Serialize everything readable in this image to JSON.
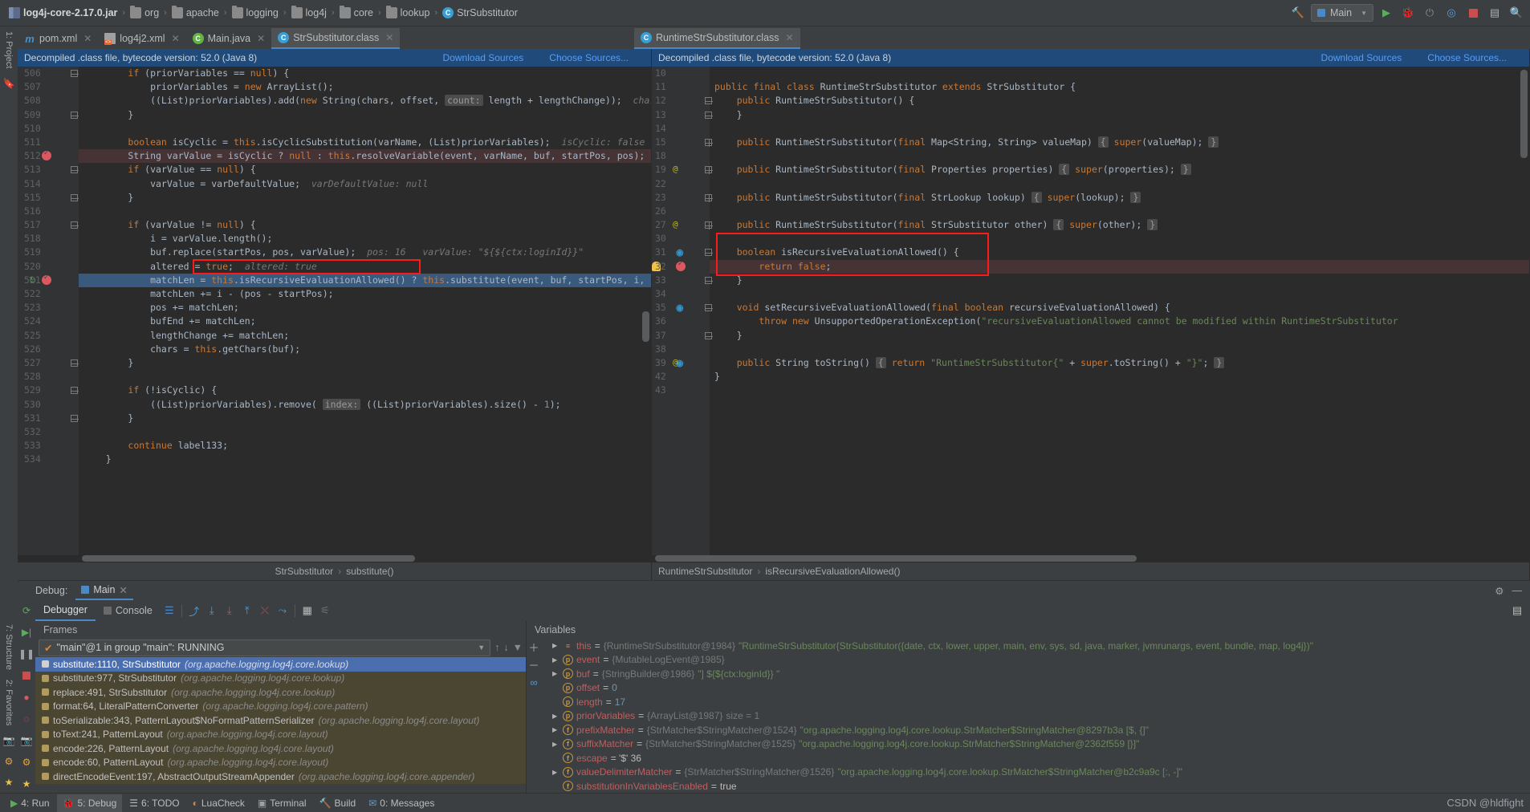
{
  "navbar": {
    "crumbs": [
      {
        "icon": "jar-icon",
        "label": "log4j-core-2.17.0.jar",
        "bold": true
      },
      {
        "icon": "folder-icon",
        "label": "org"
      },
      {
        "icon": "folder-icon",
        "label": "apache"
      },
      {
        "icon": "folder-icon",
        "label": "logging"
      },
      {
        "icon": "folder-icon",
        "label": "log4j"
      },
      {
        "icon": "folder-icon",
        "label": "core"
      },
      {
        "icon": "folder-icon",
        "label": "lookup"
      },
      {
        "icon": "class-icon",
        "label": "StrSubstitutor"
      }
    ],
    "run_config": "Main",
    "buttons": [
      "build-icon",
      "run-icon",
      "debug-icon",
      "attach-icon",
      "coverage-icon",
      "profile-icon",
      "stop-icon",
      "layout-icon",
      "search-icon"
    ]
  },
  "tabs_left": [
    {
      "icon": "maven-icon",
      "label": "pom.xml",
      "active": false
    },
    {
      "icon": "xml-icon",
      "label": "log4j2.xml",
      "active": false
    },
    {
      "icon": "java-class-icon",
      "label": "Main.java",
      "active": false
    },
    {
      "icon": "class-icon",
      "label": "StrSubstitutor.class",
      "active": true
    }
  ],
  "tabs_right": [
    {
      "icon": "class-icon",
      "label": "RuntimeStrSubstitutor.class",
      "active": true
    }
  ],
  "editor_left": {
    "notification": "Decompiled .class file, bytecode version: 52.0 (Java 8)",
    "link_download": "Download Sources",
    "link_choose": "Choose Sources...",
    "breadcrumb": [
      "StrSubstitutor",
      "substitute()"
    ],
    "lines": [
      {
        "n": "506",
        "fold": "minus",
        "html": "        <k>if</k> (priorVariables == <k>null</k>) {"
      },
      {
        "n": "507",
        "html": "            priorVariables = <k>new</k> ArrayList();"
      },
      {
        "n": "508",
        "html": "            ((List)priorVariables).add(<k>new</k> String(chars, offset, <b>count:</b> length + lengthChange));  <h>chars: {},  , $, {, c, t,</h>"
      },
      {
        "n": "509",
        "fold": "box",
        "html": "        }"
      },
      {
        "n": "510",
        "html": ""
      },
      {
        "n": "511",
        "html": "        <k>boolean</k> isCyclic = <k>this</k>.isCyclicSubstitution(varName, (List)priorVariables);  <h>isCyclic: false</h>"
      },
      {
        "n": "512",
        "bp": true,
        "bphl": true,
        "html": "        String varValue = isCyclic ? <k>null</k> : <k>this</k>.resolveVariable(event, varName, buf, startPos, pos);  <h>varValue: \"${${ctx:l</h>"
      },
      {
        "n": "513",
        "fold": "minus",
        "html": "        <k>if</k> (varValue == <k>null</k>) {"
      },
      {
        "n": "514",
        "html": "            varValue = varDefaultValue;  <h>varDefaultValue: null</h>"
      },
      {
        "n": "515",
        "fold": "box",
        "html": "        }"
      },
      {
        "n": "516",
        "html": ""
      },
      {
        "n": "517",
        "fold": "minus",
        "html": "        <k>if</k> (varValue != <k>null</k>) {"
      },
      {
        "n": "518",
        "html": "            i = varValue.length();"
      },
      {
        "n": "519",
        "html": "            buf.replace(startPos, pos, varValue);  <h>pos: 16   varValue: \"${${ctx:loginId}}\"</h>"
      },
      {
        "n": "520",
        "html": "            altered = <k>true</k>;  <h>altered: true</h>"
      },
      {
        "n": "521",
        "cur": true,
        "bp": true,
        "exec": true,
        "html": "            matchLen = <k>this</k>.isRecursiveEvaluationAllowed() ? <k>this</k>.substitute(event, buf, startPos, i, (List)priorVariables)"
      },
      {
        "n": "522",
        "html": "            matchLen += i - (pos - startPos);"
      },
      {
        "n": "523",
        "html": "            pos += matchLen;"
      },
      {
        "n": "524",
        "html": "            bufEnd += matchLen;"
      },
      {
        "n": "525",
        "html": "            lengthChange += matchLen;"
      },
      {
        "n": "526",
        "html": "            chars = <k>this</k>.getChars(buf);"
      },
      {
        "n": "527",
        "fold": "box",
        "html": "        }"
      },
      {
        "n": "528",
        "html": ""
      },
      {
        "n": "529",
        "fold": "minus",
        "html": "        <k>if</k> (!isCyclic) {"
      },
      {
        "n": "530",
        "html": "            ((List)priorVariables).remove( <b>index:</b> ((List)priorVariables).size() - <n>1</n>);"
      },
      {
        "n": "531",
        "fold": "box",
        "html": "        }"
      },
      {
        "n": "532",
        "html": ""
      },
      {
        "n": "533",
        "html": "        <k>continue</k> label133;"
      },
      {
        "n": "534",
        "html": "    }"
      }
    ]
  },
  "editor_right": {
    "notification": "Decompiled .class file, bytecode version: 52.0 (Java 8)",
    "link_download": "Download Sources",
    "link_choose": "Choose Sources...",
    "breadcrumb": [
      "RuntimeStrSubstitutor",
      "isRecursiveEvaluationAllowed()"
    ],
    "lines": [
      {
        "n": "10",
        "html": ""
      },
      {
        "n": "11",
        "html": "<k>public</k> <k>final</k> <k>class</k> RuntimeStrSubstitutor <k>extends</k> StrSubstitutor {"
      },
      {
        "n": "12",
        "fold": "minus",
        "html": "    <k>public</k> RuntimeStrSubstitutor() {"
      },
      {
        "n": "13",
        "fold": "box",
        "html": "    }"
      },
      {
        "n": "14",
        "html": ""
      },
      {
        "n": "15",
        "fold": "plus",
        "html": "    <k>public</k> RuntimeStrSubstitutor(<k>final</k> Map&lt;String, String&gt; valueMap) <b>{</b> <k>super</k>(valueMap); <b>}</b>"
      },
      {
        "n": "18",
        "html": ""
      },
      {
        "n": "19",
        "at": true,
        "fold": "plus",
        "html": "    <k>public</k> RuntimeStrSubstitutor(<k>final</k> Properties properties) <b>{</b> <k>super</k>(properties); <b>}</b>"
      },
      {
        "n": "22",
        "html": ""
      },
      {
        "n": "23",
        "fold": "plus",
        "html": "    <k>public</k> RuntimeStrSubstitutor(<k>final</k> StrLookup lookup) <b>{</b> <k>super</k>(lookup); <b>}</b>"
      },
      {
        "n": "26",
        "html": ""
      },
      {
        "n": "27",
        "at": true,
        "fold": "plus",
        "html": "    <k>public</k> RuntimeStrSubstitutor(<k>final</k> StrSubstitutor other) <b>{</b> <k>super</k>(other); <b>}</b>"
      },
      {
        "n": "30",
        "html": ""
      },
      {
        "n": "31",
        "ov": true,
        "fold": "minus",
        "html": "    <k>boolean</k> isRecursiveEvaluationAllowed() {"
      },
      {
        "n": "32",
        "bp": true,
        "bulb": true,
        "bphl": true,
        "html": "        <k>return</k> <k>false</k>;"
      },
      {
        "n": "33",
        "fold": "box",
        "html": "    }"
      },
      {
        "n": "34",
        "html": ""
      },
      {
        "n": "35",
        "ov": true,
        "fold": "minus",
        "html": "    <k>void</k> setRecursiveEvaluationAllowed(<k>final</k> <k>boolean</k> recursiveEvaluationAllowed) {"
      },
      {
        "n": "36",
        "html": "        <k>throw</k> <k>new</k> UnsupportedOperationException(<s>\"recursiveEvaluationAllowed cannot be modified within RuntimeStrSubstitutor</s>"
      },
      {
        "n": "37",
        "fold": "box",
        "html": "    }"
      },
      {
        "n": "38",
        "html": ""
      },
      {
        "n": "39",
        "ov": true,
        "at": true,
        "html": "    <k>public</k> String toString() <b>{</b> <k>return</k> <s>\"RuntimeStrSubstitutor{\"</s> + <k>super</k>.toString() + <s>\"}\"</s>; <b>}</b>"
      },
      {
        "n": "42",
        "html": "}"
      },
      {
        "n": "43",
        "html": ""
      }
    ]
  },
  "debug": {
    "label": "Debug:",
    "session_tab": "Main",
    "toolbar_tabs": [
      {
        "label": "Debugger",
        "active": true
      },
      {
        "label": "Console",
        "active": false
      }
    ],
    "toolbar_icons": [
      "layout-icon",
      "step-over-icon",
      "step-into-icon",
      "force-step-into-icon",
      "step-out-icon",
      "run-to-cursor-icon",
      "drop-frame-icon",
      "evaluate-icon",
      "settings-icon"
    ],
    "sidebar_icons": [
      "rerun-icon",
      "resume-icon",
      "pause-icon",
      "stop-icon",
      "view-breakpoints-icon",
      "mute-breakpoints-icon",
      "camera-icon",
      "settings-icon",
      "pin-icon"
    ],
    "frames_title": "Frames",
    "thread": "\"main\"@1 in group \"main\": RUNNING",
    "frames": [
      {
        "name": "substitute:1110, StrSubstitutor",
        "pkg": "(org.apache.logging.log4j.core.lookup)",
        "selected": true
      },
      {
        "name": "substitute:977, StrSubstitutor",
        "pkg": "(org.apache.logging.log4j.core.lookup)",
        "highlight": true
      },
      {
        "name": "replace:491, StrSubstitutor",
        "pkg": "(org.apache.logging.log4j.core.lookup)",
        "highlight": true
      },
      {
        "name": "format:64, LiteralPatternConverter",
        "pkg": "(org.apache.logging.log4j.core.pattern)",
        "highlight": true
      },
      {
        "name": "toSerializable:343, PatternLayout$NoFormatPatternSerializer",
        "pkg": "(org.apache.logging.log4j.core.layout)",
        "highlight": true
      },
      {
        "name": "toText:241, PatternLayout",
        "pkg": "(org.apache.logging.log4j.core.layout)",
        "highlight": true
      },
      {
        "name": "encode:226, PatternLayout",
        "pkg": "(org.apache.logging.log4j.core.layout)",
        "highlight": true
      },
      {
        "name": "encode:60, PatternLayout",
        "pkg": "(org.apache.logging.log4j.core.layout)",
        "highlight": true
      },
      {
        "name": "directEncodeEvent:197, AbstractOutputStreamAppender",
        "pkg": "(org.apache.logging.log4j.core.appender)",
        "highlight": true
      }
    ],
    "vars_title": "Variables",
    "variables": [
      {
        "arrow": true,
        "icon": "list-icon",
        "name": "this",
        "type": "{RuntimeStrSubstitutor@1984}",
        "value": "\"RuntimeStrSubstitutor{StrSubstitutor({date, ctx, lower, upper, main, env, sys, sd, java, marker, jvmrunargs, event, bundle, map, log4j})\"",
        "value_kind": "string"
      },
      {
        "arrow": true,
        "icon": "param-icon",
        "name": "event",
        "type": "{MutableLogEvent@1985}",
        "value": "",
        "value_kind": "none"
      },
      {
        "arrow": true,
        "icon": "param-icon",
        "name": "buf",
        "type": "{StringBuilder@1986}",
        "value": "\"] ${${ctx:loginId}} \"",
        "value_kind": "string"
      },
      {
        "arrow": false,
        "icon": "param-icon",
        "name": "offset",
        "type": "",
        "value": "0",
        "value_kind": "num"
      },
      {
        "arrow": false,
        "icon": "param-icon",
        "name": "length",
        "type": "",
        "value": "17",
        "value_kind": "num"
      },
      {
        "arrow": true,
        "icon": "param-icon",
        "name": "priorVariables",
        "type": "{ArrayList@1987}",
        "value": "size = 1",
        "value_kind": "size"
      },
      {
        "arrow": true,
        "icon": "field-icon",
        "name": "prefixMatcher",
        "type": "{StrMatcher$StringMatcher@1524}",
        "value": "\"org.apache.logging.log4j.core.lookup.StrMatcher$StringMatcher@8297b3a [$, {]\"",
        "value_kind": "string"
      },
      {
        "arrow": true,
        "icon": "field-icon",
        "name": "suffixMatcher",
        "type": "{StrMatcher$StringMatcher@1525}",
        "value": "\"org.apache.logging.log4j.core.lookup.StrMatcher$StringMatcher@2362f559 [}]\"",
        "value_kind": "string"
      },
      {
        "arrow": false,
        "icon": "field-icon",
        "name": "escape",
        "type": "",
        "value": "= '$' 36",
        "value_kind": "plain"
      },
      {
        "arrow": true,
        "icon": "field-icon",
        "name": "valueDelimiterMatcher",
        "type": "{StrMatcher$StringMatcher@1526}",
        "value": "\"org.apache.logging.log4j.core.lookup.StrMatcher$StringMatcher@b2c9a9c [:, -]\"",
        "value_kind": "string"
      },
      {
        "arrow": false,
        "icon": "field-icon",
        "name": "substitutionInVariablesEnabled",
        "type": "",
        "value": "true",
        "value_kind": "plain"
      }
    ]
  },
  "statusbar": {
    "items": [
      {
        "icon": "run-icon",
        "label": "4: Run"
      },
      {
        "icon": "debug-icon",
        "label": "5: Debug",
        "active": true
      },
      {
        "icon": "todo-icon",
        "label": "6: TODO"
      },
      {
        "icon": "lua-icon",
        "label": "LuaCheck"
      },
      {
        "icon": "terminal-icon",
        "label": "Terminal"
      },
      {
        "icon": "build-icon",
        "label": "Build"
      },
      {
        "icon": "messages-icon",
        "label": "0: Messages"
      }
    ],
    "watermark": "CSDN @hldfight"
  },
  "left_rail": {
    "top": [
      "1: Project"
    ],
    "bottom": [
      "7: Structure",
      "2: Favorites"
    ]
  },
  "colors": {
    "accent": "#4a88c7",
    "selection": "#4b6eaf",
    "breakpoint": "#db5860",
    "keyword": "#cc7832",
    "string": "#6a8759",
    "highlight_box": "#ff1a1a",
    "editor_bg": "#2b2b2b",
    "panel_bg": "#3c3f41"
  }
}
